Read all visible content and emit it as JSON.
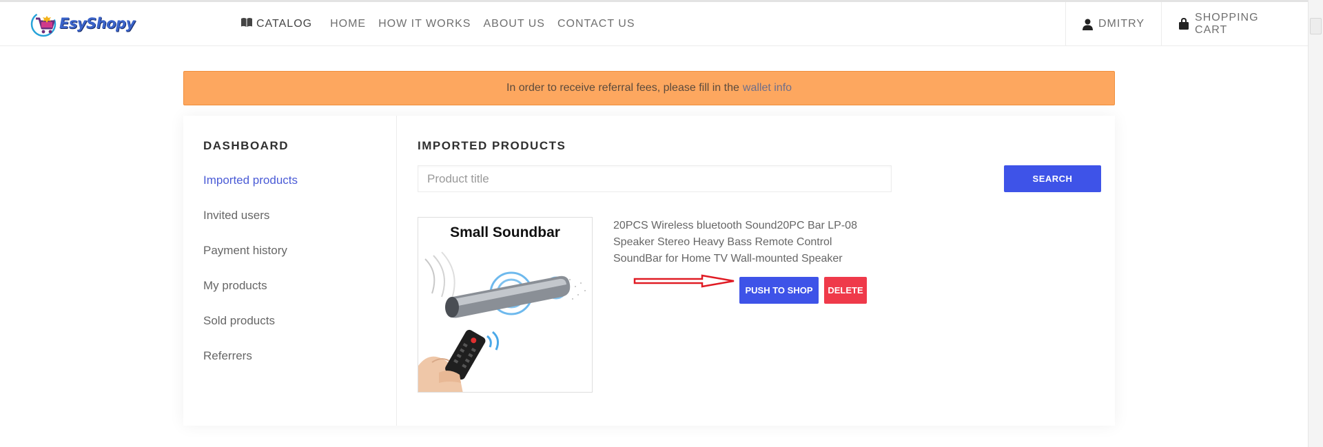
{
  "brand": {
    "name": "EsyShopy",
    "logo_icon": "shopping-cart-logo"
  },
  "nav": {
    "catalog": "CATALOG",
    "links": [
      "HOME",
      "HOW IT WORKS",
      "ABOUT US",
      "CONTACT US"
    ],
    "user": "DMITRY",
    "cart": "SHOPPING CART"
  },
  "alert": {
    "text": "In order to receive referral fees, please fill in the",
    "link": "wallet info",
    "color": "#fda75f"
  },
  "sidebar": {
    "title": "DASHBOARD",
    "items": [
      {
        "label": "Imported products",
        "active": true
      },
      {
        "label": "Invited users",
        "active": false
      },
      {
        "label": "Payment history",
        "active": false
      },
      {
        "label": "My products",
        "active": false
      },
      {
        "label": "Sold products",
        "active": false
      },
      {
        "label": "Referrers",
        "active": false
      }
    ]
  },
  "main": {
    "title": "IMPORTED PRODUCTS",
    "search": {
      "placeholder": "Product title",
      "value": "",
      "button": "SEARCH"
    },
    "product": {
      "image_caption": "Small  Soundbar",
      "title": "20PCS Wireless bluetooth Sound20PC Bar LP-08 Speaker Stereo Heavy Bass Remote Control SoundBar for Home TV Wall-mounted Speaker",
      "push_button": "PUSH TO SHOP",
      "delete_button": "DELETE"
    }
  },
  "colors": {
    "primary": "#3e53e8",
    "danger": "#ef3a4a",
    "active_link": "#4a5bd6",
    "arrow": "#e01b24"
  }
}
